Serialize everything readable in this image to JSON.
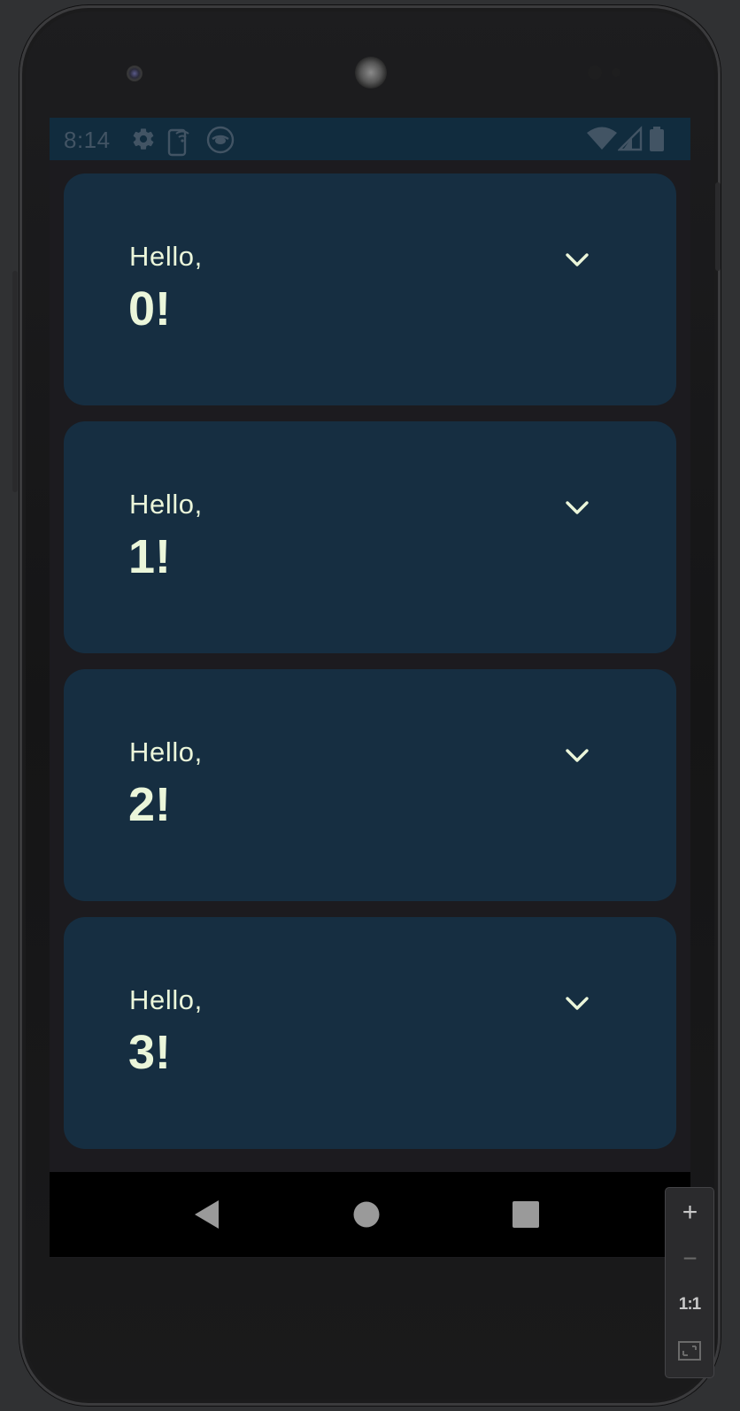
{
  "status_bar": {
    "time": "8:14",
    "left_icons": [
      "settings-icon",
      "phone-signal-icon",
      "cast-icon"
    ],
    "right_icons": [
      "wifi-icon",
      "cell-signal-icon",
      "battery-icon"
    ]
  },
  "cards": [
    {
      "greeting": "Hello,",
      "name": "0!",
      "expand_icon": "chevron-down-icon"
    },
    {
      "greeting": "Hello,",
      "name": "1!",
      "expand_icon": "chevron-down-icon"
    },
    {
      "greeting": "Hello,",
      "name": "2!",
      "expand_icon": "chevron-down-icon"
    },
    {
      "greeting": "Hello,",
      "name": "3!",
      "expand_icon": "chevron-down-icon"
    }
  ],
  "nav_bar": {
    "buttons": [
      "back-icon",
      "home-icon",
      "recents-icon"
    ]
  },
  "zoom_controls": {
    "zoom_in": "+",
    "zoom_out": "−",
    "actual_size": "1:1",
    "fit_icon": "fit-screen-icon"
  },
  "colors": {
    "card_background": "#162e41",
    "card_text": "#ebf6da",
    "status_bar_background": "#112c3e",
    "screen_background": "#1c1b1f"
  }
}
